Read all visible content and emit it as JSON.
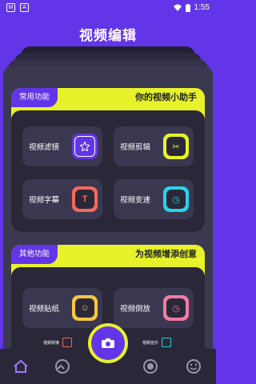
{
  "status": {
    "time": "1:55",
    "left_icons": [
      "M",
      "A"
    ]
  },
  "title": "视频编辑",
  "section1": {
    "tag": "常用功能",
    "slogan": "你的视频小助手",
    "tiles": [
      {
        "label": "视频滤镜",
        "icon": "filter-icon",
        "color": "#6236e8"
      },
      {
        "label": "视频剪辑",
        "icon": "scissors-icon",
        "color": "#e7f22a"
      },
      {
        "label": "视频字幕",
        "icon": "text-icon",
        "color": "#f06a5a"
      },
      {
        "label": "视频变速",
        "icon": "speed-icon",
        "color": "#2ad1e6"
      }
    ]
  },
  "section2": {
    "tag": "其他功能",
    "slogan": "为视频增添创意",
    "tiles": [
      {
        "label": "视频贴纸",
        "icon": "sticker-icon",
        "color": "#f4c542"
      },
      {
        "label": "视频倒放",
        "icon": "reverse-icon",
        "color": "#f07aa0"
      }
    ],
    "mini_tiles": [
      {
        "label": "视频拼接"
      },
      {
        "label": "视频音乐"
      }
    ]
  },
  "colors": {
    "accent": "#6236e8",
    "lime": "#e7f22a",
    "dark": "#2a2838"
  },
  "nav": [
    "home-icon",
    "photo-icon",
    "camera-icon",
    "record-icon",
    "smile-icon"
  ]
}
